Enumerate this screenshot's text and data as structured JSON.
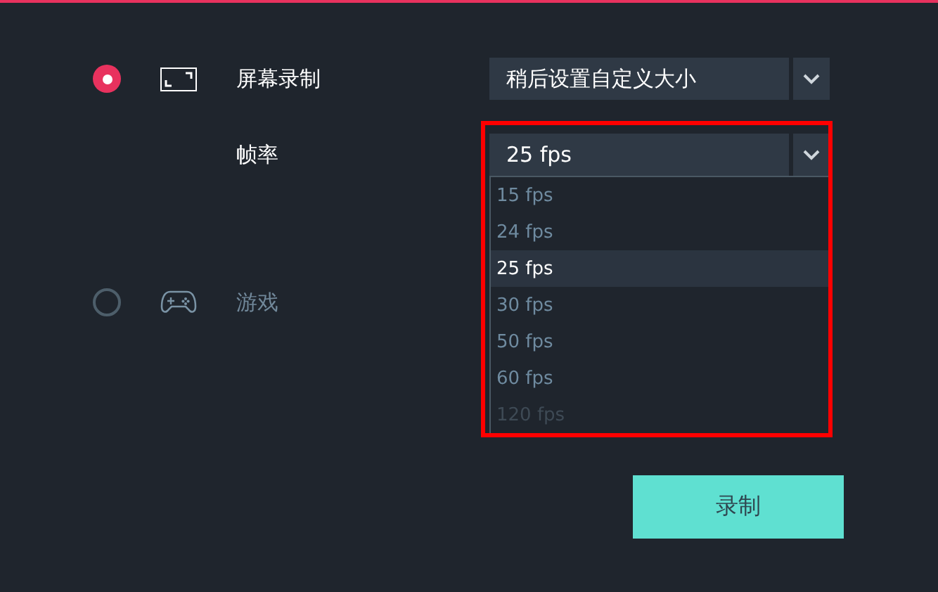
{
  "capture_modes": [
    {
      "kind": "screen",
      "label": "屏幕录制",
      "selected": true,
      "size_select": {
        "value": "稍后设置自定义大小"
      }
    },
    {
      "kind": "game",
      "label": "游戏",
      "selected": false
    }
  ],
  "frame_rate": {
    "label": "帧率",
    "value": "25 fps",
    "expanded": true,
    "highlighted": true,
    "options": [
      {
        "label": "15 fps",
        "selected": false,
        "disabled": false
      },
      {
        "label": "24 fps",
        "selected": false,
        "disabled": false
      },
      {
        "label": "25 fps",
        "selected": true,
        "disabled": false
      },
      {
        "label": "30 fps",
        "selected": false,
        "disabled": false
      },
      {
        "label": "50 fps",
        "selected": false,
        "disabled": false
      },
      {
        "label": "60 fps",
        "selected": false,
        "disabled": false
      },
      {
        "label": "120 fps",
        "selected": false,
        "disabled": true
      }
    ]
  },
  "record_button": "录制"
}
